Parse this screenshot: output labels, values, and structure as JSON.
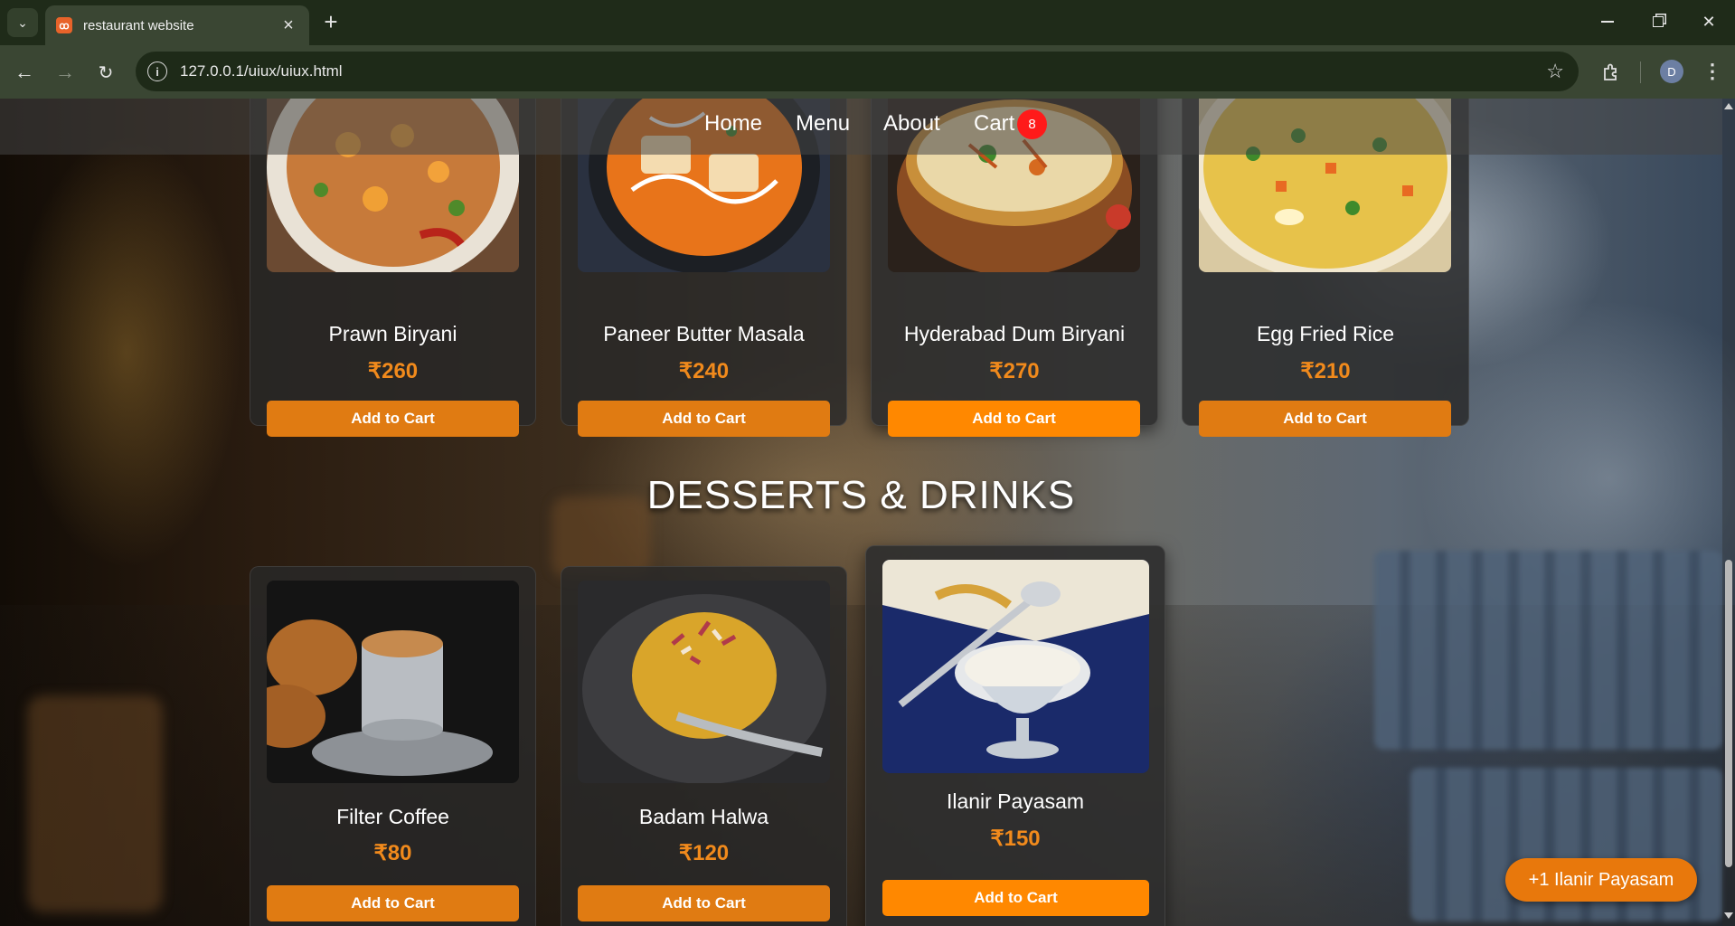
{
  "browser": {
    "tab_title": "restaurant website",
    "url": "127.0.0.1/uiux/uiux.html",
    "profile_initial": "D"
  },
  "nav": {
    "home": "Home",
    "menu": "Menu",
    "about": "About",
    "cart": "Cart",
    "cart_count": "8"
  },
  "main_items": [
    {
      "name": "Prawn Biryani",
      "price": "₹260",
      "button": "Add to Cart"
    },
    {
      "name": "Paneer Butter Masala",
      "price": "₹240",
      "button": "Add to Cart"
    },
    {
      "name": "Hyderabad Dum Biryani",
      "price": "₹270",
      "button": "Add to Cart"
    },
    {
      "name": "Egg Fried Rice",
      "price": "₹210",
      "button": "Add to Cart"
    }
  ],
  "desserts_title": "DESSERTS & DRINKS",
  "dessert_items": [
    {
      "name": "Filter Coffee",
      "price": "₹80",
      "button": "Add to Cart"
    },
    {
      "name": "Badam Halwa",
      "price": "₹120",
      "button": "Add to Cart"
    },
    {
      "name": "Ilanir Payasam",
      "price": "₹150",
      "button": "Add to Cart"
    }
  ],
  "toast": "+1 Ilanir Payasam",
  "colors": {
    "accent": "#e07b12",
    "price": "#f18a1c",
    "badge": "#ff1a1a"
  }
}
